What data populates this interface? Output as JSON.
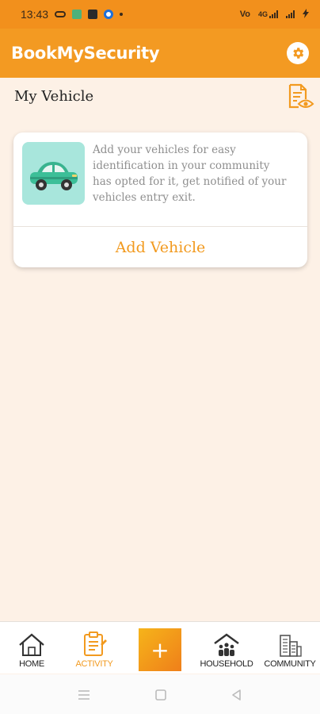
{
  "status_bar": {
    "time": "13:43",
    "icons": [
      "link-icon",
      "app-icon",
      "facebook-icon",
      "messenger-icon",
      "dot-icon"
    ],
    "right_icons": [
      "vowifi-icon",
      "signal-icon",
      "signal-icon",
      "charging-icon"
    ],
    "right_text_1": "Vo",
    "right_text_2": "4G"
  },
  "app": {
    "title": "BookMySecurity",
    "accent_color": "#f39a22",
    "settings_icon": "gear-icon"
  },
  "page": {
    "title": "My Vehicle",
    "action_icon": "document-eye-icon"
  },
  "card": {
    "image_icon": "car-icon",
    "description": "Add your vehicles for easy identification in your community has opted for it, get notified of your vehicles entry exit.",
    "button_label": "Add Vehicle"
  },
  "bottom_nav": {
    "items": [
      {
        "label": "HOME",
        "icon": "home-icon"
      },
      {
        "label": "ACTIVITY",
        "icon": "clipboard-icon",
        "active": true
      },
      {
        "label": "+",
        "icon": "plus-icon"
      },
      {
        "label": "HOUSEHOLD",
        "icon": "household-icon"
      },
      {
        "label": "COMMUNITY",
        "icon": "buildings-icon"
      }
    ]
  },
  "system_nav": [
    "menu-icon",
    "home-square-icon",
    "back-triangle-icon"
  ]
}
